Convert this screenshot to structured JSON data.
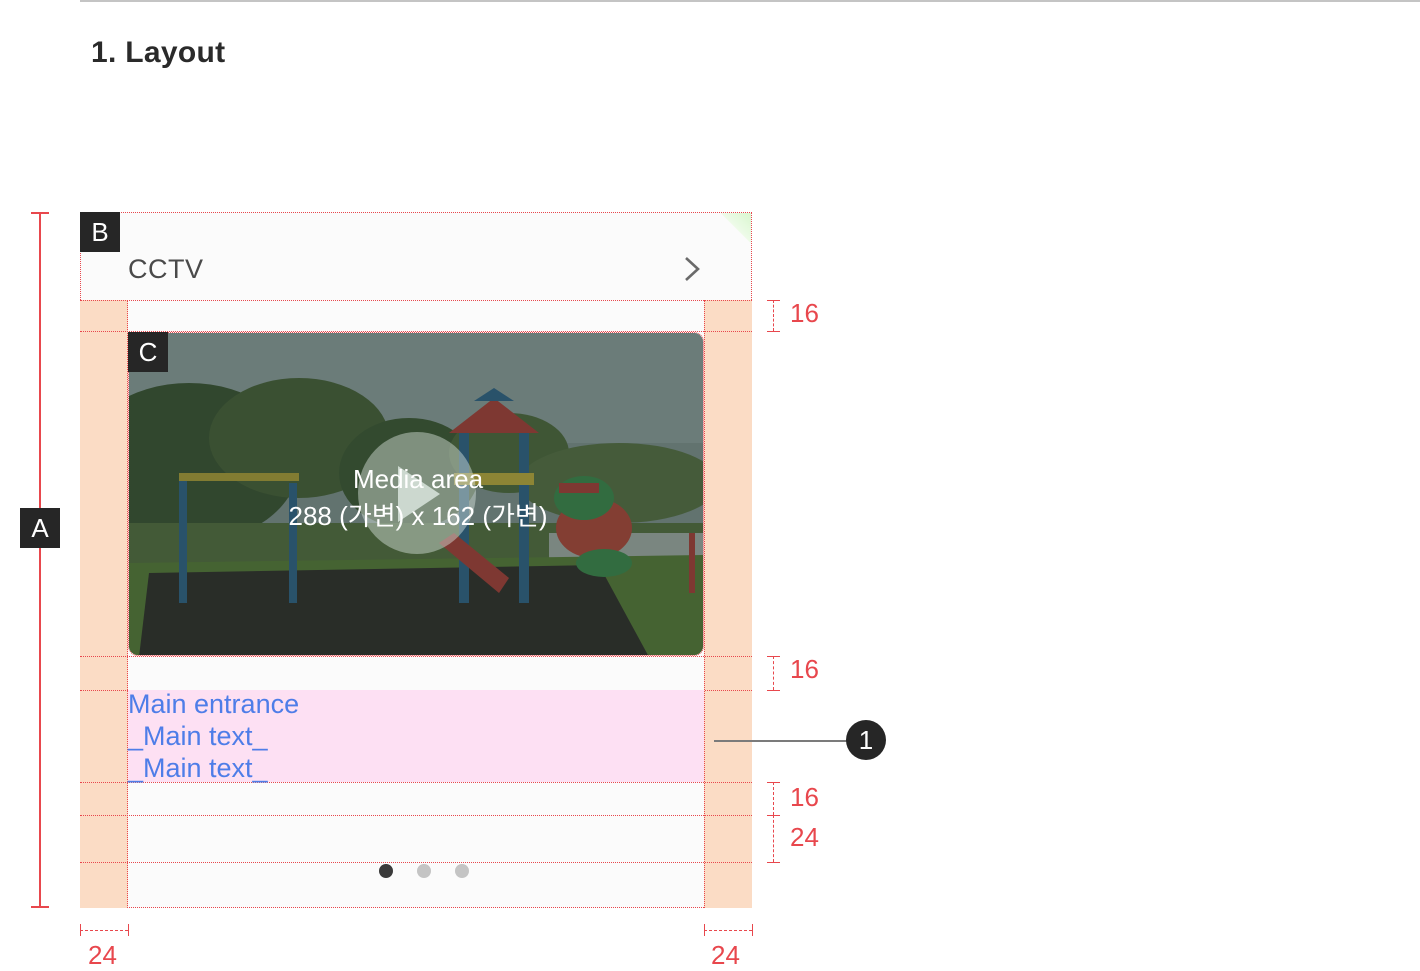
{
  "section": {
    "title": "1. Layout"
  },
  "tags": {
    "a": "A",
    "b": "B",
    "c": "C"
  },
  "card": {
    "header_label": "CCTV",
    "header_icon": "chevron-right-icon",
    "media_caption_line1": "Media area",
    "media_caption_line2": "288 (가변) x 162 (가변)",
    "media_icon": "play-icon",
    "text_lines": [
      "Main entrance",
      "_Main text_",
      "_Main text_"
    ],
    "page_dots": {
      "count": 3,
      "active_index": 0
    }
  },
  "dimensions": {
    "media_top_gap": "16",
    "media_bottom_gap": "16",
    "text_bottom_gap": "16",
    "indicator_height": "24",
    "left_padding": "24",
    "right_padding": "24"
  },
  "callout": {
    "number": "1"
  },
  "colors": {
    "measure": "#e8474d",
    "padding_fill": "#fbdcc5",
    "text_area_fill": "#fde0f3",
    "text_color": "#4e7de8",
    "dot_active": "#3a3a3a",
    "dot_inactive": "#c4c4c4"
  }
}
